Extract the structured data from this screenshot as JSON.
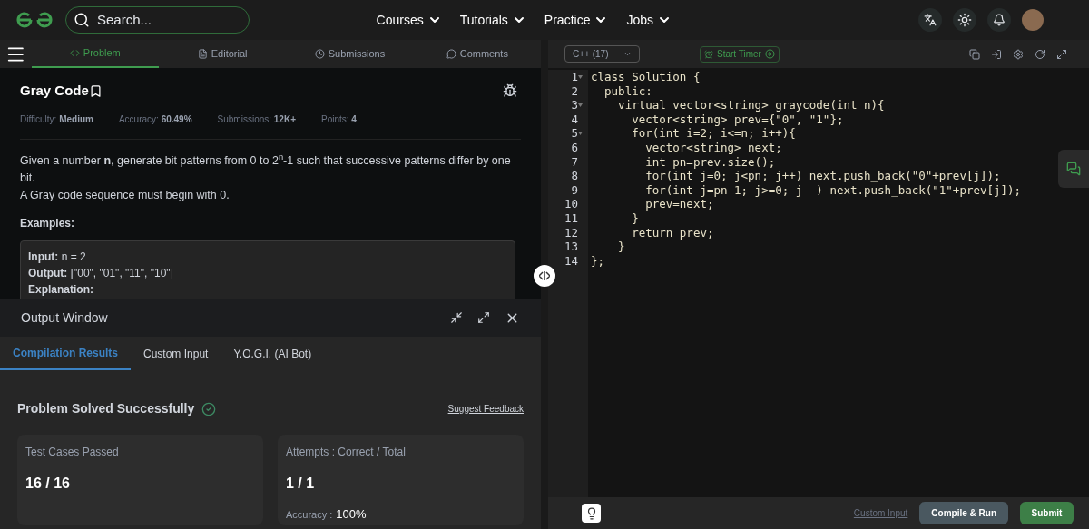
{
  "header": {
    "search": {
      "placeholder": "Search..."
    },
    "nav": [
      "Courses",
      "Tutorials",
      "Practice",
      "Jobs"
    ]
  },
  "problem_tabs": [
    {
      "label": "Problem",
      "selected": true
    },
    {
      "label": "Editorial",
      "selected": false
    },
    {
      "label": "Submissions",
      "selected": false
    },
    {
      "label": "Comments",
      "selected": false
    }
  ],
  "problem": {
    "title": "Gray Code",
    "meta": [
      {
        "label": "Difficulty:",
        "value": "Medium"
      },
      {
        "label": "Accuracy:",
        "value": "60.49%"
      },
      {
        "label": "Submissions:",
        "value": "12K+"
      },
      {
        "label": "Points:",
        "value": "4"
      }
    ],
    "description": [
      "Given a number **n**, generate bit patterns from 0 to 2$^{n}$-1 such that successive patterns differ by one bit.",
      "A Gray code sequence must begin with 0."
    ],
    "examples_heading": "Examples:",
    "example": [
      {
        "label": "Input:",
        "value": "n = 2"
      },
      {
        "label": "Output:",
        "value": "[\"00\", \"01\", \"11\", \"10\"]"
      },
      {
        "label": "Explanation:"
      }
    ]
  },
  "output_window": {
    "title": "Output Window",
    "tabs": [
      {
        "label": "Compilation Results",
        "selected": true
      },
      {
        "label": "Custom Input",
        "selected": false
      },
      {
        "label": "Y.O.G.I. (AI Bot)",
        "selected": false
      }
    ],
    "status": "Problem Solved Successfully",
    "feedback_link": "Suggest Feedback",
    "cards": [
      {
        "label": "Test Cases Passed",
        "value": "16 / 16"
      },
      {
        "label": "Attempts : Correct / Total",
        "value": "1 / 1",
        "extra_label": "Accuracy :",
        "extra_value": "100%"
      }
    ]
  },
  "editor": {
    "language": "C++ (17)",
    "timer": "Start Timer",
    "lines": [
      {
        "number": "1",
        "text": "class Solution {",
        "foldable": true
      },
      {
        "number": "2",
        "text": "  public:",
        "foldable": false
      },
      {
        "number": "3",
        "text": "    virtual vector<string> graycode(int n){",
        "foldable": true
      },
      {
        "number": "4",
        "text": "      vector<string> prev={\"0\", \"1\"};",
        "foldable": false
      },
      {
        "number": "5",
        "text": "      for(int i=2; i<=n; i++){",
        "foldable": true
      },
      {
        "number": "6",
        "text": "        vector<string> next;",
        "foldable": false
      },
      {
        "number": "7",
        "text": "        int pn=prev.size();",
        "foldable": false
      },
      {
        "number": "8",
        "text": "        for(int j=0; j<pn; j++) next.push_back(\"0\"+prev[j]);",
        "foldable": false
      },
      {
        "number": "9",
        "text": "        for(int j=pn-1; j>=0; j--) next.push_back(\"1\"+prev[j]);",
        "foldable": false
      },
      {
        "number": "10",
        "text": "        prev=next;",
        "foldable": false
      },
      {
        "number": "11",
        "text": "      }",
        "foldable": false
      },
      {
        "number": "12",
        "text": "      return prev;",
        "foldable": false
      },
      {
        "number": "13",
        "text": "    }",
        "foldable": false
      },
      {
        "number": "14",
        "text": "};",
        "foldable": false
      }
    ],
    "footer": {
      "custom_input": "Custom Input",
      "compile": "Compile & Run",
      "submit": "Submit"
    }
  }
}
